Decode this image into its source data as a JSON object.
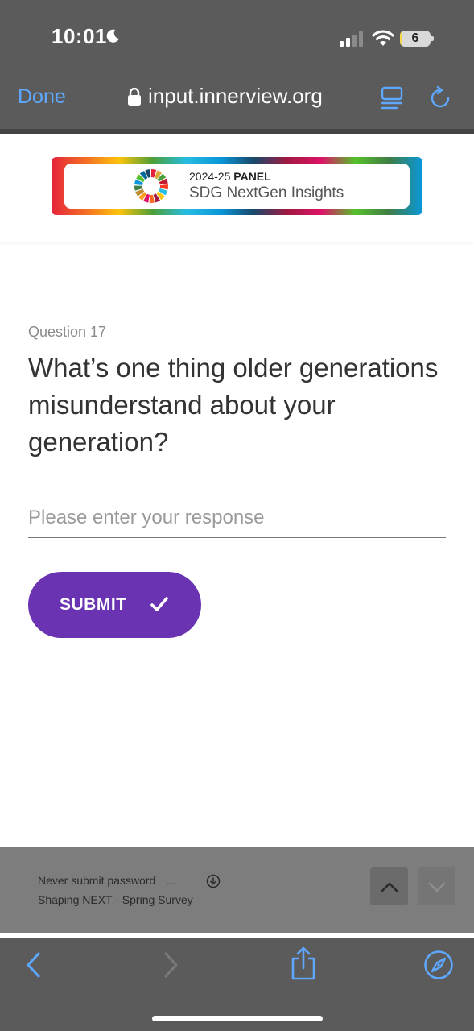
{
  "status_bar": {
    "time": "10:01",
    "battery_level": "6"
  },
  "browser": {
    "done_label": "Done",
    "url": "input.innerview.org"
  },
  "banner": {
    "year": "2024-25",
    "panel": "PANEL",
    "subtitle": "SDG NextGen Insights"
  },
  "question": {
    "number_label": "Question 17",
    "text": "What’s one thing older generations misunderstand about your generation?"
  },
  "response": {
    "placeholder": "Please enter your response",
    "value": ""
  },
  "submit": {
    "label": "SUBMIT"
  },
  "autofill": {
    "line1": "Never submit password",
    "ellipsis": "...",
    "line2": "Shaping NEXT - Spring Survey"
  },
  "colors": {
    "accent": "#6a33b2",
    "ios_blue": "#5ea8ff",
    "chrome_gray": "#5b5b5b"
  },
  "icons": {
    "status": [
      "moon-icon",
      "signal-icon",
      "wifi-icon",
      "battery-icon"
    ],
    "browser": [
      "lock-icon",
      "reader-icon",
      "reload-icon"
    ],
    "toolbar": [
      "back-chevron-icon",
      "forward-chevron-icon",
      "share-icon",
      "compass-icon"
    ]
  }
}
